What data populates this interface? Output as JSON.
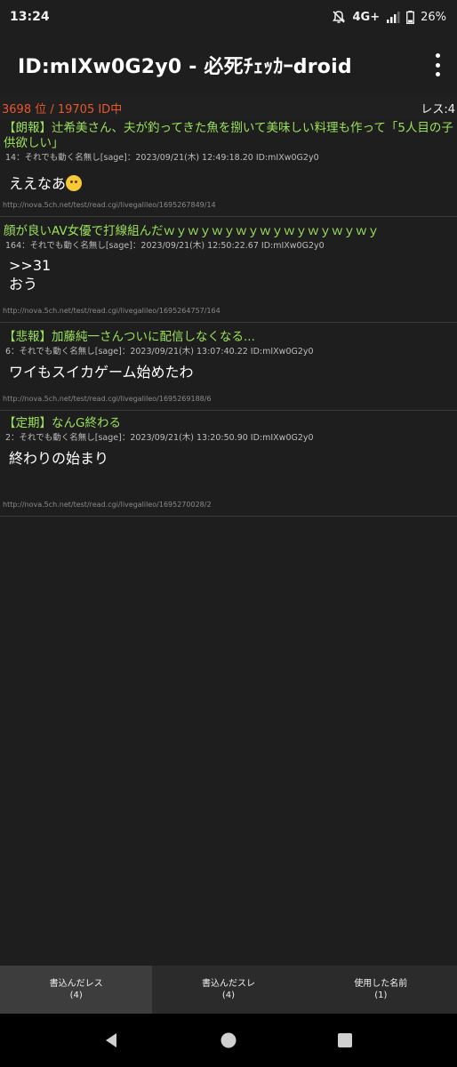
{
  "status": {
    "time": "13:24",
    "network": "4G+",
    "battery": "26%",
    "icons": [
      "bell-off-icon",
      "signal-icon",
      "battery-icon"
    ]
  },
  "app": {
    "title": "ID:mIXw0G2y0 - 必死ﾁｪｯｶｰdroid"
  },
  "summary": {
    "rank": "3698 位 / 19705 ID中",
    "count": "レス:4"
  },
  "posts": [
    {
      "thread": "【朗報】辻希美さん、夫が釣ってきた魚を捌いて美味しい料理も作って「5人目の子供欲しい」",
      "meta": "14：それでも動く名無し[sage]：2023/09/21(木) 12:49:18.20 ID:mIXw0G2y0",
      "body": "ええなあ",
      "url": "http://nova.5ch.net/test/read.cgi/livegalileo/1695267849/14"
    },
    {
      "thread": "顔が良いAV女優で打線組んだｗｙｗｙｗｙｗｙｗｙｗｙｗｙｗｙｗｙ",
      "meta": "164：それでも動く名無し[sage]：2023/09/21(木) 12:50:22.67 ID:mIXw0G2y0",
      "body": ">>31",
      "body2": "おう",
      "url": "http://nova.5ch.net/test/read.cgi/livegalileo/1695264757/164"
    },
    {
      "thread": "【悲報】加藤純一さんついに配信しなくなる...",
      "meta": "6：それでも動く名無し[sage]：2023/09/21(木) 13:07:40.22 ID:mIXw0G2y0",
      "body": "ワイもスイカゲーム始めたわ",
      "url": "http://nova.5ch.net/test/read.cgi/livegalileo/1695269188/6"
    },
    {
      "thread": "【定期】なんG終わる",
      "meta": "2：それでも動く名無し[sage]：2023/09/21(木) 13:20:50.90 ID:mIXw0G2y0",
      "body": "終わりの始まり",
      "url": "http://nova.5ch.net/test/read.cgi/livegalileo/1695270028/2"
    }
  ],
  "tabs": [
    {
      "label": "書込んだレス",
      "count": "(4)"
    },
    {
      "label": "書込んだスレ",
      "count": "(4)"
    },
    {
      "label": "使用した名前",
      "count": "(1)"
    }
  ],
  "colors": {
    "thread_title": "#9be25a",
    "rank": "#e8572d",
    "background": "#1e1e1f"
  }
}
